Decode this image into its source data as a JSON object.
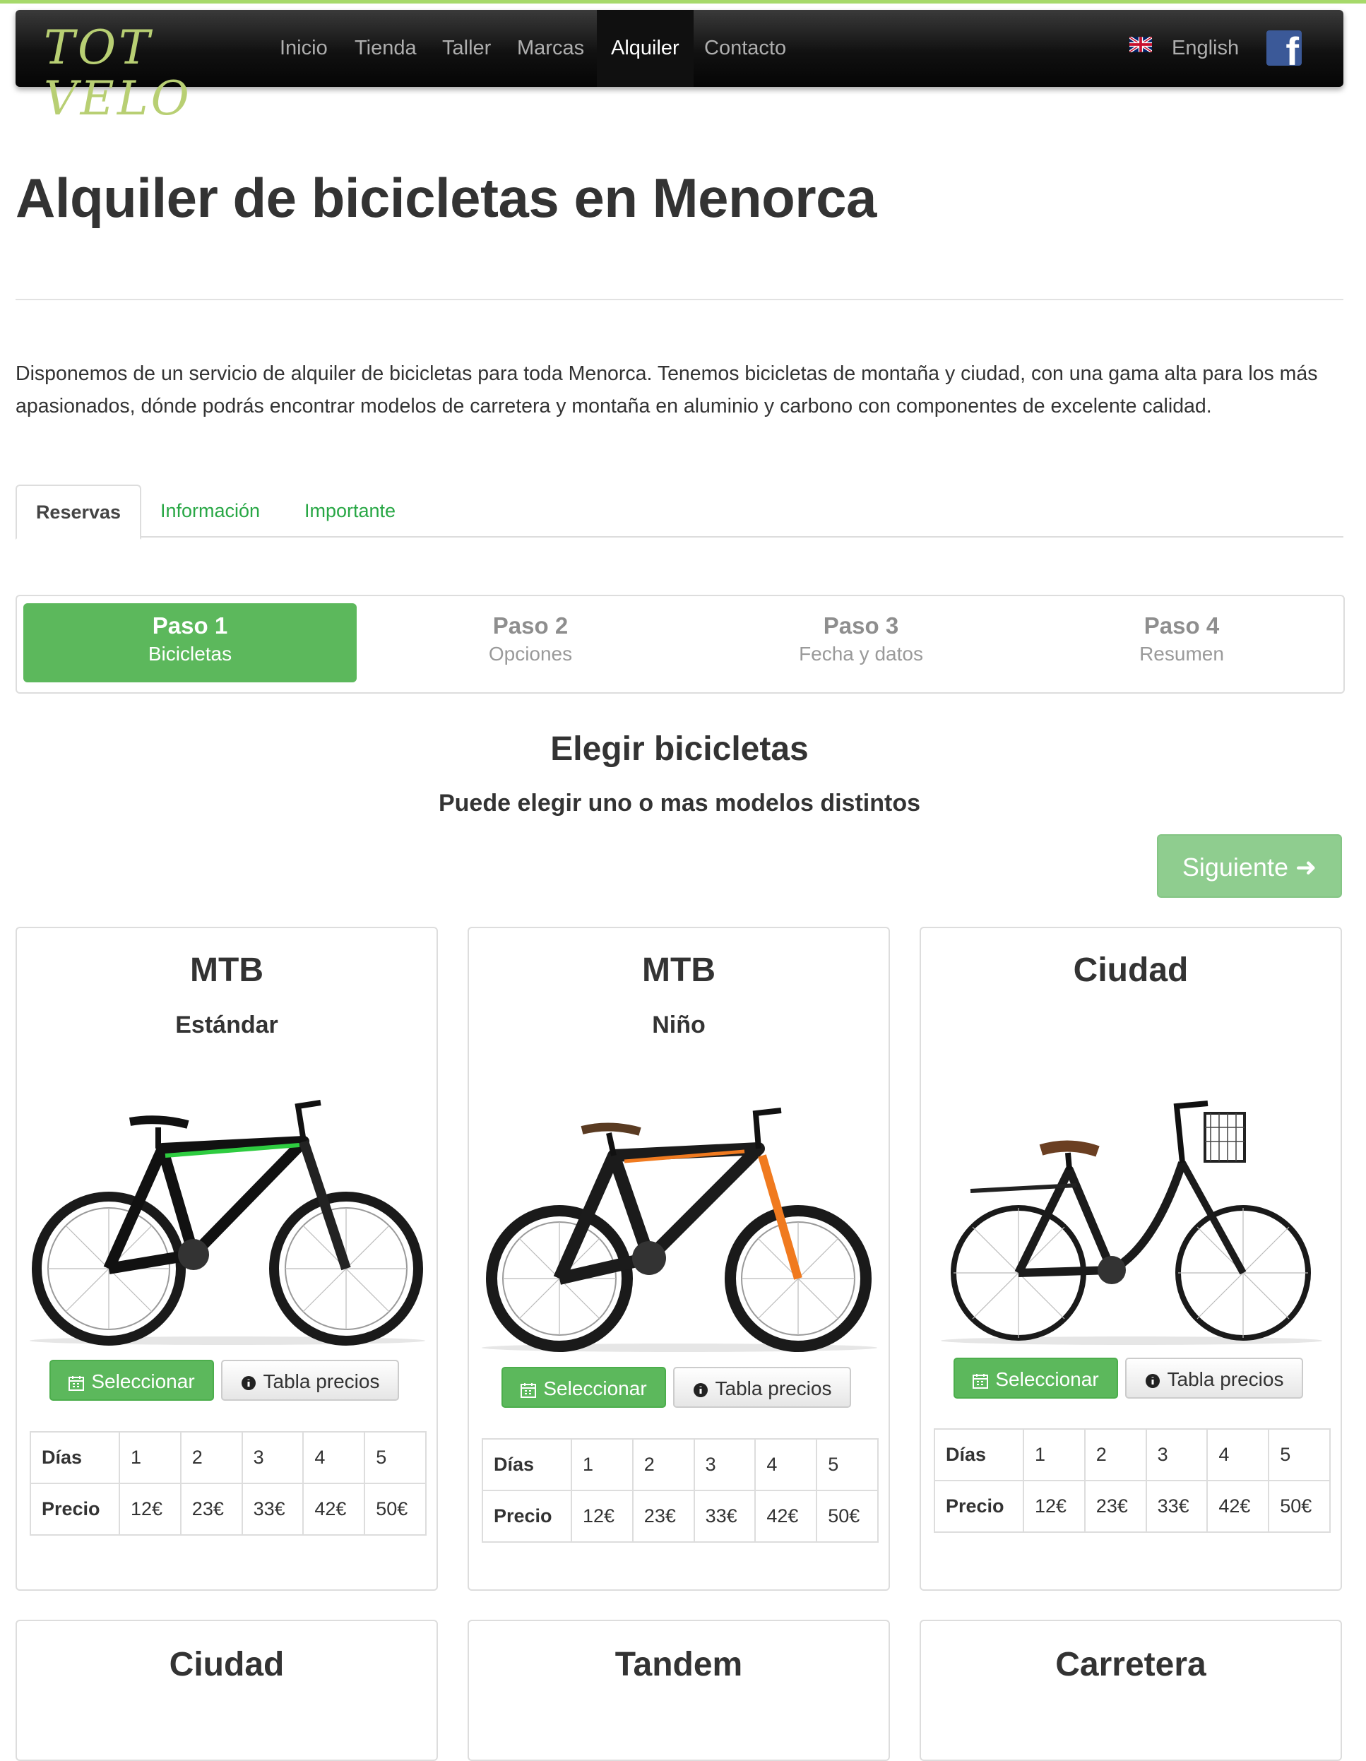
{
  "nav": {
    "logo": "TOT VELO",
    "items": [
      "Inicio",
      "Tienda",
      "Taller",
      "Marcas",
      "Alquiler",
      "Contacto"
    ],
    "language": "English",
    "facebook_letter": "f"
  },
  "page": {
    "title": "Alquiler de bicicletas en Menorca",
    "intro": "Disponemos de un servicio de alquiler de bicicletas para toda Menorca. Tenemos bicicletas de montaña y ciudad, con una gama alta para los más apasionados, dónde podrás encontrar modelos de carretera y montaña en aluminio y carbono con componentes de excelente calidad."
  },
  "tabs": [
    "Reservas",
    "Información",
    "Importante"
  ],
  "steps": [
    {
      "title": "Paso 1",
      "subtitle": "Bicicletas"
    },
    {
      "title": "Paso 2",
      "subtitle": "Opciones"
    },
    {
      "title": "Paso 3",
      "subtitle": "Fecha y datos"
    },
    {
      "title": "Paso 4",
      "subtitle": "Resumen"
    }
  ],
  "selection": {
    "title": "Elegir bicicletas",
    "subtitle": "Puede elegir uno o mas modelos distintos",
    "next_button": "Siguiente ➜"
  },
  "bikes": [
    {
      "name": "MTB",
      "variant": "Estándar",
      "select_label": "Seleccionar",
      "prices_label": "Tabla precios",
      "days_label": "Días",
      "price_label": "Precio",
      "days": [
        "1",
        "2",
        "3",
        "4",
        "5"
      ],
      "prices": [
        "12€",
        "23€",
        "33€",
        "42€",
        "50€"
      ]
    },
    {
      "name": "MTB",
      "variant": "Niño",
      "select_label": "Seleccionar",
      "prices_label": "Tabla precios",
      "days_label": "Días",
      "price_label": "Precio",
      "days": [
        "1",
        "2",
        "3",
        "4",
        "5"
      ],
      "prices": [
        "12€",
        "23€",
        "33€",
        "42€",
        "50€"
      ]
    },
    {
      "name": "Ciudad",
      "variant": "",
      "select_label": "Seleccionar",
      "prices_label": "Tabla precios",
      "days_label": "Días",
      "price_label": "Precio",
      "days": [
        "1",
        "2",
        "3",
        "4",
        "5"
      ],
      "prices": [
        "12€",
        "23€",
        "33€",
        "42€",
        "50€"
      ]
    },
    {
      "name": "Ciudad"
    },
    {
      "name": "Tandem"
    },
    {
      "name": "Carretera"
    }
  ],
  "colors": {
    "accent": "#5cb85c",
    "link": "#28a745",
    "nav_bg": "#111111",
    "top_line": "#a6d96a"
  }
}
